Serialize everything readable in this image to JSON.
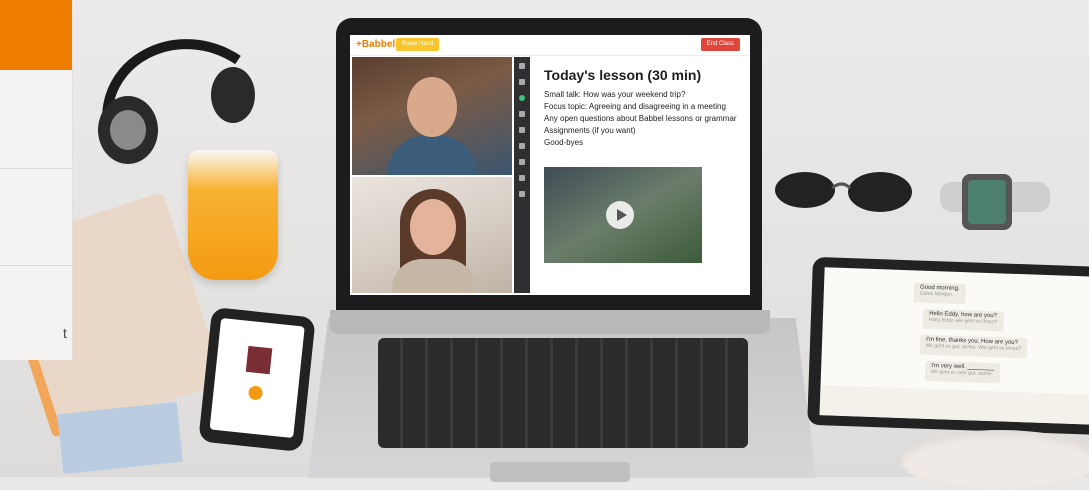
{
  "left_panel": {
    "partial_text": "t"
  },
  "app": {
    "logo": "+Babbel",
    "raise_hand": "Raise Hand",
    "end_class": "End Class",
    "lesson_title": "Today's lesson (30 min)",
    "agenda": [
      "Small talk: How was your weekend trip?",
      "Focus topic: Agreeing and disagreeing in a meeting",
      "Any open questions about Babbel lessons or grammar",
      "Assignments (if you want)",
      "Good-byes"
    ],
    "video_thumbnail_icon": "play-icon",
    "toolbar_icons": [
      "arrow-icon",
      "square-icon",
      "circle-icon",
      "pen-icon",
      "text-icon",
      "image-icon",
      "plus-icon",
      "brush-icon",
      "camera-icon"
    ]
  },
  "tablet": {
    "messages": [
      {
        "text": "Good morning.",
        "sub": "Guten Morgen."
      },
      {
        "text": "Hello Eddy, how are you?",
        "sub": "Hallo Eddy, wie geht es Ihnen?"
      },
      {
        "text": "I'm fine, thanks you. How are you?",
        "sub": "Mir geht es gut, danke. Wie geht es Ihnen?"
      },
      {
        "text": "I'm very well. ________",
        "sub": "Mir geht es sehr gut, danke."
      }
    ]
  },
  "colors": {
    "brand": "#ef7d00",
    "end_class": "#e0463a",
    "raise_hand": "#f9c52b"
  }
}
